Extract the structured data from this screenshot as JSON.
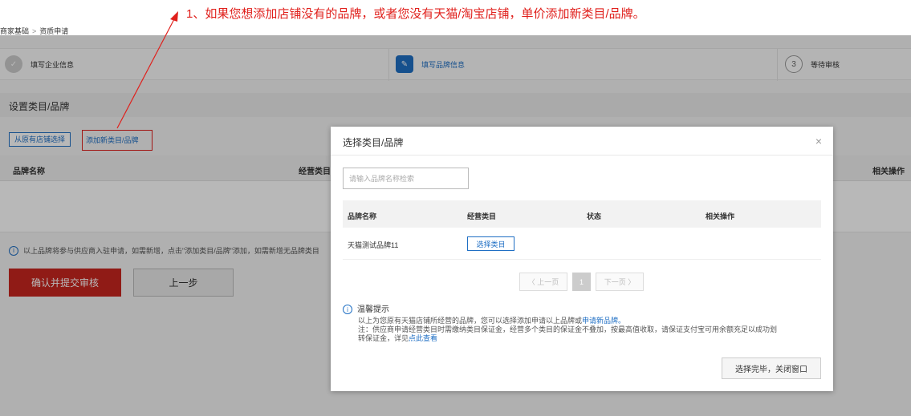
{
  "annotation": "1、如果您想添加店铺没有的品牌，或者您没有天猫/淘宝店铺，单价添加新类目/品牌。",
  "breadcrumb": {
    "root": "商家基础",
    "separator": ">",
    "current": "资质申请"
  },
  "steps": [
    {
      "label": "填写企业信息",
      "icon": "check-icon"
    },
    {
      "label": "填写品牌信息",
      "icon": "edit-icon"
    },
    {
      "label": "等待审核",
      "number": "3"
    }
  ],
  "section": {
    "title": "设置类目/品牌",
    "from_store_button": "从原有店铺选择",
    "add_new_link": "添加新类目/品牌",
    "columns": [
      "品牌名称",
      "经营类目",
      "相关操作"
    ],
    "note": "以上品牌将参与供应商入驻申请，如需新增，点击\"添加类目/品牌\"添加，如需新增无品牌类目"
  },
  "actions": {
    "submit": "确认并提交审核",
    "prev": "上一步"
  },
  "modal": {
    "title": "选择类目/品牌",
    "close": "×",
    "search_placeholder": "请输入品牌名称检索",
    "columns": [
      "品牌名称",
      "经营类目",
      "状态",
      "相关操作"
    ],
    "rows": [
      {
        "brand": "天猫测试品牌11",
        "action": "选择类目"
      }
    ],
    "pager": {
      "prev": "〈 上一页",
      "page": "1",
      "next": "下一页 〉"
    },
    "tips": {
      "title": "温馨提示",
      "line1": "以上为您原有天猫店铺所经营的品牌，您可以选择添加申请以上品牌或",
      "line1_link": "申请新品牌。",
      "line2": "注：供应商申请经营类目时需缴纳类目保证金，经营多个类目的保证金不叠加，按最高值收取，请保证支付宝可用余额充足以成功划",
      "line3": "转保证金，详见",
      "line3_link": "点此查看"
    },
    "done_button": "选择完毕，关闭窗口"
  },
  "colors": {
    "accent": "#1f6fc4",
    "danger": "#c8261f",
    "annotation": "#e0201c"
  }
}
